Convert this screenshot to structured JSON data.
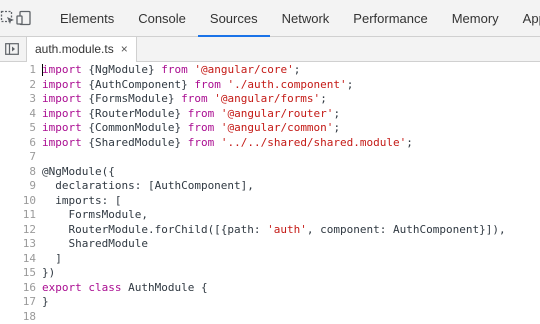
{
  "devtools": {
    "tabs": [
      "Elements",
      "Console",
      "Sources",
      "Network",
      "Performance",
      "Memory",
      "Applica"
    ],
    "active_tab": "Sources"
  },
  "editor": {
    "file_tab": {
      "name": "auth.module.ts",
      "close": "×"
    },
    "lines": [
      [
        [
          "import",
          "kw"
        ],
        [
          " {NgModule} ",
          "id"
        ],
        [
          "from",
          "kw"
        ],
        [
          " ",
          "id"
        ],
        [
          "'@angular/core'",
          "str"
        ],
        [
          ";",
          "id"
        ]
      ],
      [
        [
          "import",
          "kw"
        ],
        [
          " {AuthComponent} ",
          "id"
        ],
        [
          "from",
          "kw"
        ],
        [
          " ",
          "id"
        ],
        [
          "'./auth.component'",
          "str"
        ],
        [
          ";",
          "id"
        ]
      ],
      [
        [
          "import",
          "kw"
        ],
        [
          " {FormsModule} ",
          "id"
        ],
        [
          "from",
          "kw"
        ],
        [
          " ",
          "id"
        ],
        [
          "'@angular/forms'",
          "str"
        ],
        [
          ";",
          "id"
        ]
      ],
      [
        [
          "import",
          "kw"
        ],
        [
          " {RouterModule} ",
          "id"
        ],
        [
          "from",
          "kw"
        ],
        [
          " ",
          "id"
        ],
        [
          "'@angular/router'",
          "str"
        ],
        [
          ";",
          "id"
        ]
      ],
      [
        [
          "import",
          "kw"
        ],
        [
          " {CommonModule} ",
          "id"
        ],
        [
          "from",
          "kw"
        ],
        [
          " ",
          "id"
        ],
        [
          "'@angular/common'",
          "str"
        ],
        [
          ";",
          "id"
        ]
      ],
      [
        [
          "import",
          "kw"
        ],
        [
          " {SharedModule} ",
          "id"
        ],
        [
          "from",
          "kw"
        ],
        [
          " ",
          "id"
        ],
        [
          "'../../shared/shared.module'",
          "str"
        ],
        [
          ";",
          "id"
        ]
      ],
      [],
      [
        [
          "@NgModule({",
          "id"
        ]
      ],
      [
        [
          "  declarations: [AuthComponent],",
          "id"
        ]
      ],
      [
        [
          "  imports: [",
          "id"
        ]
      ],
      [
        [
          "    FormsModule,",
          "id"
        ]
      ],
      [
        [
          "    RouterModule.forChild([{path: ",
          "id"
        ],
        [
          "'auth'",
          "str"
        ],
        [
          ", component: AuthComponent}]),",
          "id"
        ]
      ],
      [
        [
          "    SharedModule",
          "id"
        ]
      ],
      [
        [
          "  ]",
          "id"
        ]
      ],
      [
        [
          "})",
          "id"
        ]
      ],
      [
        [
          "export",
          "kw"
        ],
        [
          " ",
          "id"
        ],
        [
          "class",
          "kw"
        ],
        [
          " AuthModule {",
          "id"
        ]
      ],
      [
        [
          "}",
          "id"
        ]
      ],
      []
    ]
  }
}
